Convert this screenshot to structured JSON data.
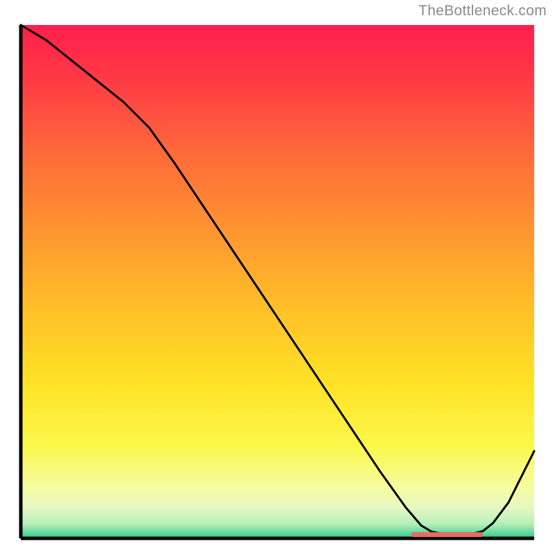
{
  "attribution": "TheBottleneck.com",
  "chart_data": {
    "type": "line",
    "title": "",
    "xlabel": "",
    "ylabel": "",
    "xlim": [
      0,
      100
    ],
    "ylim": [
      0,
      100
    ],
    "series": [
      {
        "name": "curve",
        "x": [
          0,
          5,
          10,
          15,
          20,
          25,
          30,
          35,
          40,
          45,
          50,
          55,
          60,
          65,
          70,
          75,
          78,
          80,
          82,
          84,
          86,
          88,
          90,
          92,
          95,
          100
        ],
        "y": [
          100,
          97,
          93,
          89,
          85,
          80,
          73,
          65.5,
          58,
          50.5,
          43,
          35.5,
          28,
          20.5,
          13,
          6,
          2.5,
          1.3,
          0.9,
          0.8,
          0.8,
          0.9,
          1.4,
          3,
          7,
          17
        ]
      }
    ],
    "band": {
      "name": "optimal-band",
      "x_start": 76,
      "x_end": 90,
      "y": 0.8,
      "color": "#e86a6a"
    },
    "gradient_stops": [
      {
        "offset": 0.0,
        "color": "#ff1f4b"
      },
      {
        "offset": 0.1,
        "color": "#ff3846"
      },
      {
        "offset": 0.25,
        "color": "#ff6a3a"
      },
      {
        "offset": 0.4,
        "color": "#ff9530"
      },
      {
        "offset": 0.55,
        "color": "#ffbf28"
      },
      {
        "offset": 0.7,
        "color": "#ffe326"
      },
      {
        "offset": 0.82,
        "color": "#fbf84a"
      },
      {
        "offset": 0.9,
        "color": "#f6fca0"
      },
      {
        "offset": 0.94,
        "color": "#e6f8c2"
      },
      {
        "offset": 0.972,
        "color": "#b6efb9"
      },
      {
        "offset": 0.99,
        "color": "#5bd99a"
      },
      {
        "offset": 1.0,
        "color": "#29c77f"
      }
    ]
  }
}
